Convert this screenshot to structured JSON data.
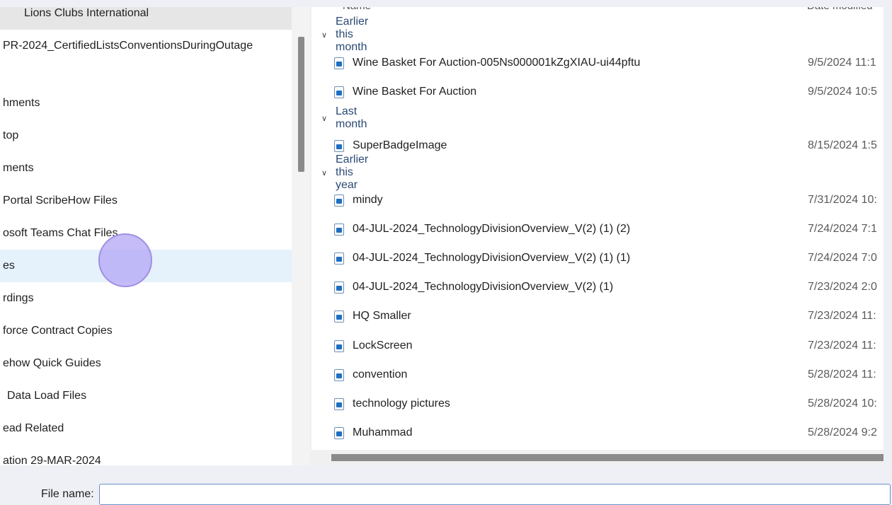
{
  "nav": {
    "items": [
      {
        "label": "Lions Clubs International"
      },
      {
        "label": "PR-2024_CertifiedListsConventionsDuringOutage"
      },
      {
        "label": ""
      },
      {
        "label": "hments"
      },
      {
        "label": "top"
      },
      {
        "label": "ments"
      },
      {
        "label": "Portal ScribeHow Files"
      },
      {
        "label": "osoft Teams Chat Files"
      },
      {
        "label": "es"
      },
      {
        "label": "rdings"
      },
      {
        "label": "force Contract Copies"
      },
      {
        "label": "ehow Quick Guides"
      },
      {
        "label": "Data Load Files"
      },
      {
        "label": "ead Related"
      },
      {
        "label": "ation 29-MAR-2024"
      }
    ]
  },
  "files": {
    "columns": {
      "name": "Name",
      "date": "Date modified"
    },
    "groups": [
      {
        "label": "Earlier this month",
        "items": [
          {
            "name": "Wine Basket For Auction-005Ns000001kZgXIAU-ui44pftu",
            "date": "9/5/2024 11:1"
          },
          {
            "name": "Wine Basket For Auction",
            "date": "9/5/2024 10:5"
          }
        ]
      },
      {
        "label": "Last month",
        "items": [
          {
            "name": "SuperBadgeImage",
            "date": "8/15/2024 1:5"
          }
        ]
      },
      {
        "label": "Earlier this year",
        "items": [
          {
            "name": "mindy",
            "date": "7/31/2024 10:"
          },
          {
            "name": "04-JUL-2024_TechnologyDivisionOverview_V(2) (1) (2)",
            "date": "7/24/2024 7:1"
          },
          {
            "name": "04-JUL-2024_TechnologyDivisionOverview_V(2) (1) (1)",
            "date": "7/24/2024 7:0"
          },
          {
            "name": "04-JUL-2024_TechnologyDivisionOverview_V(2) (1)",
            "date": "7/23/2024 2:0"
          },
          {
            "name": "HQ Smaller",
            "date": "7/23/2024 11:"
          },
          {
            "name": "LockScreen",
            "date": "7/23/2024 11:"
          },
          {
            "name": "convention",
            "date": "5/28/2024 11:"
          },
          {
            "name": "technology pictures",
            "date": "5/28/2024 10:"
          },
          {
            "name": "Muhammad",
            "date": "5/28/2024 9:2"
          }
        ]
      }
    ]
  },
  "footer": {
    "file_name_label": "File name:",
    "file_name_value": ""
  },
  "icons": {
    "group_chevron": "chevron-down-icon",
    "file_icon": "image-file-icon"
  },
  "colors": {
    "hover_row": "#e5f1fb",
    "group_header_text": "#2b4a75",
    "cursor_highlight": "#b1a6f5"
  }
}
